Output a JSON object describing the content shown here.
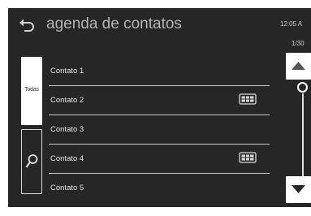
{
  "header": {
    "title": "agenda de contatos",
    "clock": "12:05 A",
    "page_counter": "1/30"
  },
  "filters": {
    "all_label": "Todas"
  },
  "contacts": [
    {
      "name": "Contato 1",
      "card_icon": false
    },
    {
      "name": "Contato 2",
      "card_icon": true
    },
    {
      "name": "Contato 3",
      "card_icon": false
    },
    {
      "name": "Contato 4",
      "card_icon": true
    },
    {
      "name": "Contato 5",
      "card_icon": false
    }
  ],
  "icons": {
    "back": "back-arrow-icon",
    "search": "search-icon",
    "card": "contact-card-icon",
    "scroll_up": "up-arrow-icon",
    "scroll_down": "down-arrow-icon"
  },
  "colors": {
    "background": "#262626",
    "text": "#e6e6e6",
    "title": "#b5b5b5",
    "separator": "#c8c8c8",
    "button": "#ffffff"
  }
}
